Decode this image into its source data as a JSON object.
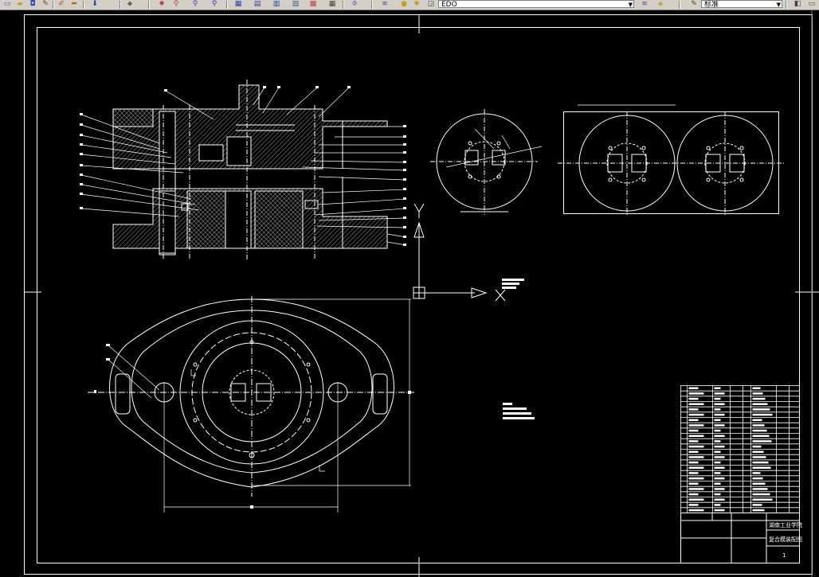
{
  "toolbar": {
    "icons": [
      "new-file-icon",
      "open-folder-icon",
      "save-icon",
      "print-icon",
      "pan-icon",
      "zoom-realtime-icon",
      "zoom-window-icon",
      "zoom-previous-icon",
      "properties-icon",
      "design-center-icon",
      "tool-palette-icon",
      "calculator-icon",
      "layer-manager-icon",
      "layer-state-icon",
      "linetype-icon",
      "lineweight-icon",
      "text-style-icon"
    ],
    "layer_combo_value": "EDO",
    "style_combo_value": "标准"
  },
  "drawing": {
    "title_block": {
      "school": "湖南工业学院",
      "drawing_title": "复合模装配图",
      "sheet_number": "1"
    }
  },
  "colors": {
    "background": "#000000",
    "linework": "#ffffff",
    "toolbar": "#d4d0c8"
  }
}
